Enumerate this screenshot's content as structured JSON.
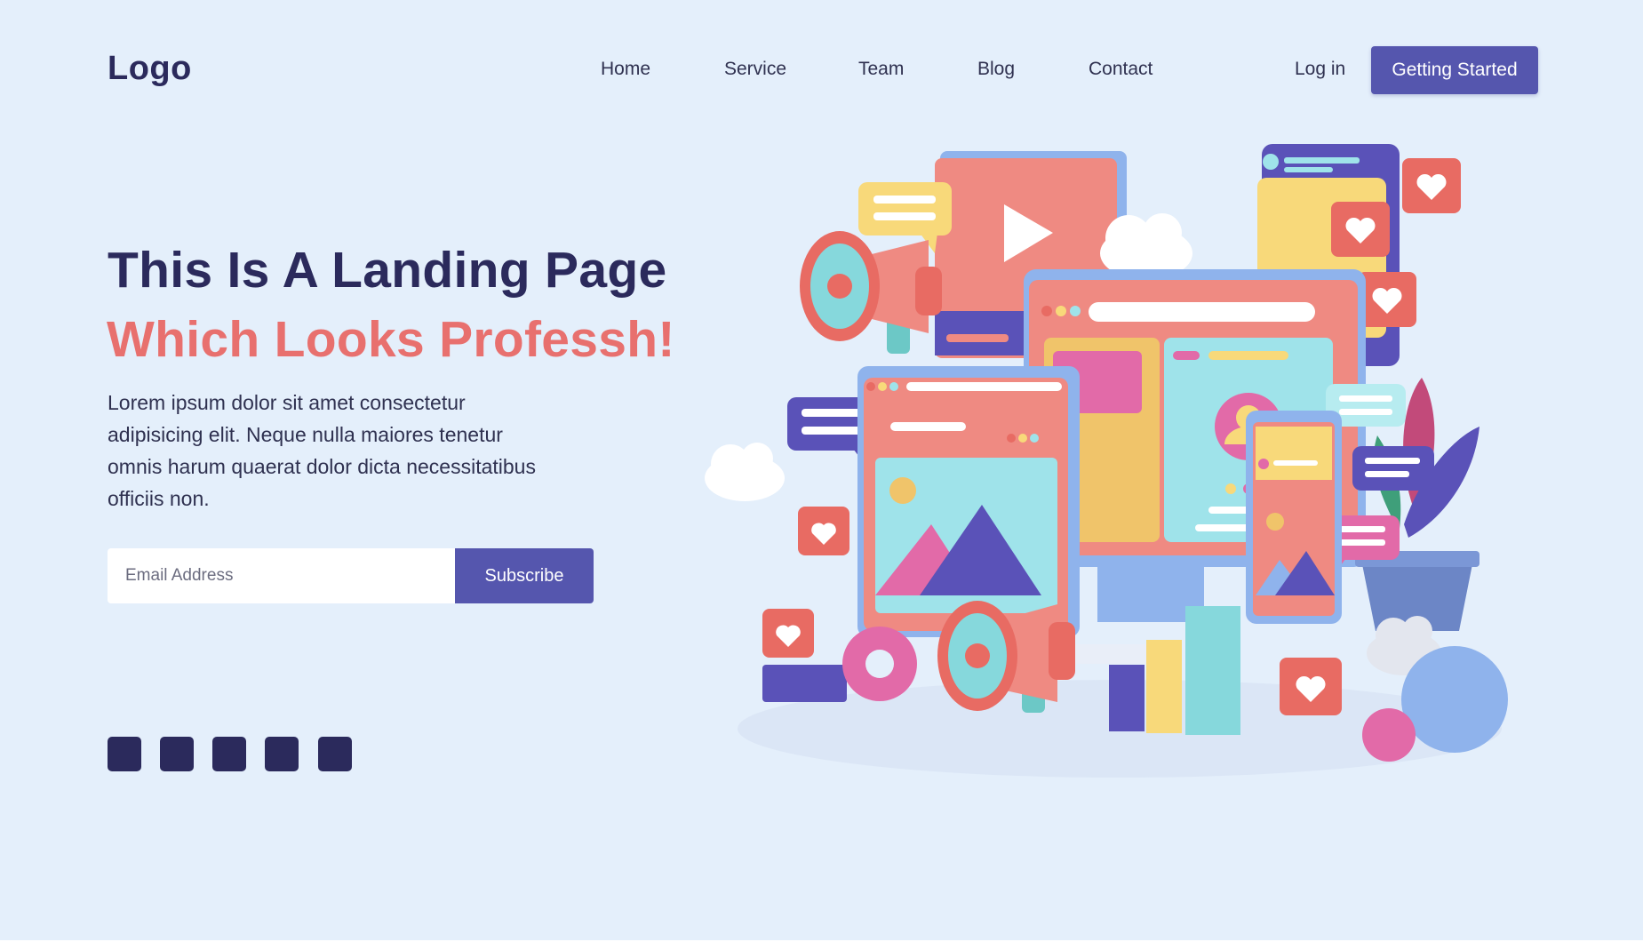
{
  "header": {
    "logo": "Logo",
    "nav": [
      "Home",
      "Service",
      "Team",
      "Blog",
      "Contact"
    ],
    "login": "Log in",
    "cta": "Getting Started"
  },
  "hero": {
    "title": "This Is A Landing Page",
    "subtitle": "Which Looks Professh!",
    "description": "Lorem ipsum dolor sit amet consectetur adipisicing elit. Neque nulla maiores tenetur omnis harum quaerat dolor dicta necessitatibus officiis non.",
    "email_placeholder": "Email Address",
    "subscribe_label": "Subscribe"
  },
  "social_icons": [
    "social-icon",
    "social-icon",
    "social-icon",
    "social-icon",
    "social-icon"
  ],
  "colors": {
    "background": "#e4effb",
    "primary": "#5556ae",
    "heading": "#2b2a5c",
    "accent": "#e8706e"
  }
}
